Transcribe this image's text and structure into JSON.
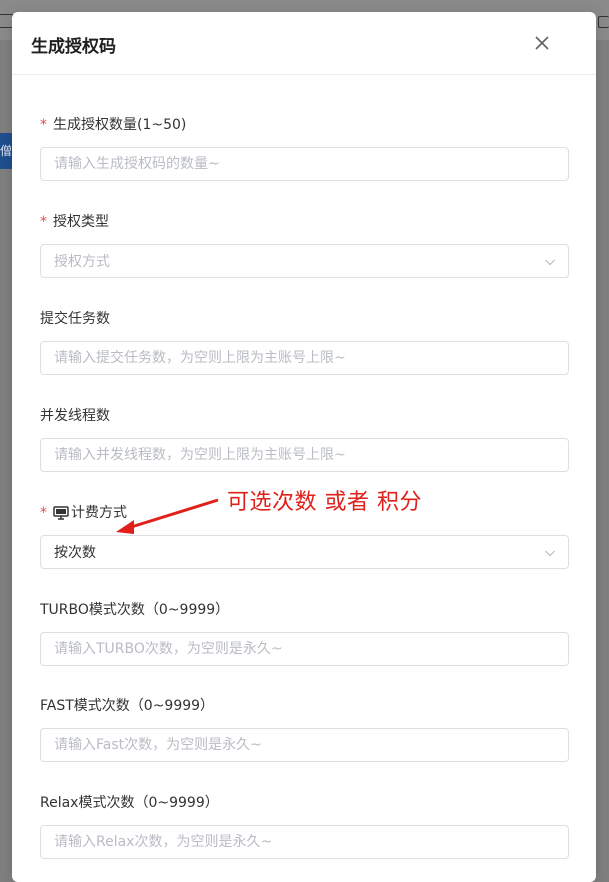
{
  "dialog": {
    "title": "生成授权码",
    "close_icon": "close-icon"
  },
  "fields": {
    "auth_count": {
      "label": "生成授权数量(1~50)",
      "required": true,
      "placeholder": "请输入生成授权码的数量~"
    },
    "auth_type": {
      "label": "授权类型",
      "required": true,
      "placeholder": "授权方式"
    },
    "task_count": {
      "label": "提交任务数",
      "required": false,
      "placeholder": "请输入提交任务数，为空则上限为主账号上限~"
    },
    "thread_count": {
      "label": "并发线程数",
      "required": false,
      "placeholder": "请输入并发线程数，为空则上限为主账号上限~"
    },
    "billing": {
      "label": "计费方式",
      "required": true,
      "icon": "monitor-icon",
      "value": "按次数"
    },
    "turbo": {
      "label": "TURBO模式次数（0~9999）",
      "placeholder": "请输入TURBO次数，为空则是永久~"
    },
    "fast": {
      "label": "FAST模式次数（0~9999）",
      "placeholder": "请输入Fast次数，为空则是永久~"
    },
    "relax": {
      "label": "Relax模式次数（0~9999）",
      "placeholder": "请输入Relax次数，为空则是永久~"
    }
  },
  "background": {
    "left_tab_text": "僧"
  },
  "annotation": {
    "text": "可选次数 或者 积分",
    "color": "#e0201a"
  },
  "colors": {
    "required_star": "#e34c4c",
    "border": "#dcdfe6",
    "placeholder": "#b9bcc4"
  }
}
